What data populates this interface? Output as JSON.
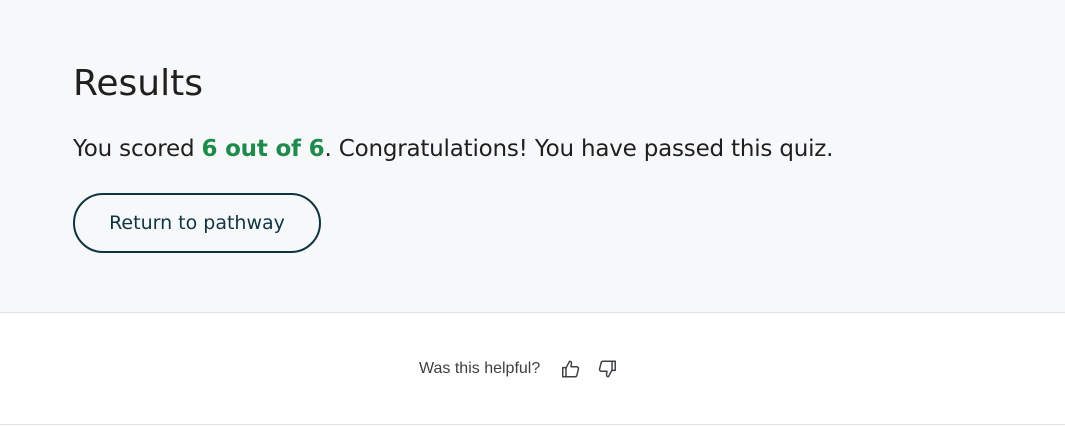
{
  "results": {
    "title": "Results",
    "score_prefix": "You scored ",
    "score_value": "6 out of 6",
    "score_suffix": ". Congratulations! You have passed this quiz.",
    "return_button_label": "Return to pathway"
  },
  "feedback": {
    "question": "Was this helpful?",
    "thumbs_up_icon": "thumbs-up-icon",
    "thumbs_down_icon": "thumbs-down-icon"
  },
  "colors": {
    "score_green": "#1e8a4c",
    "button_border": "#0e3440",
    "panel_background": "#f7f8fa"
  }
}
